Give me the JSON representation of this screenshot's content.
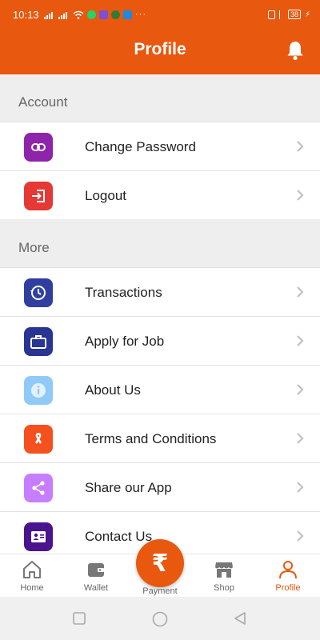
{
  "status": {
    "time": "10:13",
    "battery": "38"
  },
  "header": {
    "title": "Profile"
  },
  "sections": {
    "account": {
      "title": "Account",
      "items": [
        {
          "label": "Change Password",
          "icon": "link-icon",
          "color": "#8e24aa"
        },
        {
          "label": "Logout",
          "icon": "logout-icon",
          "color": "#e53935"
        }
      ]
    },
    "more": {
      "title": "More",
      "items": [
        {
          "label": "Transactions",
          "icon": "history-icon",
          "color": "#303f9f"
        },
        {
          "label": "Apply for Job",
          "icon": "briefcase-icon",
          "color": "#283593"
        },
        {
          "label": "About Us",
          "icon": "info-icon",
          "color": "#90caf9"
        },
        {
          "label": "Terms and Conditions",
          "icon": "ribbon-icon",
          "color": "#f4511e"
        },
        {
          "label": "Share our App",
          "icon": "share-icon",
          "color": "#c77dff"
        },
        {
          "label": "Contact Us",
          "icon": "contact-card-icon",
          "color": "#4a148c"
        }
      ]
    }
  },
  "nav": {
    "home": "Home",
    "wallet": "Wallet",
    "payment": "Payment",
    "payment_symbol": "₹",
    "shop": "Shop",
    "profile": "Profile"
  },
  "colors": {
    "brand": "#e8580f"
  }
}
